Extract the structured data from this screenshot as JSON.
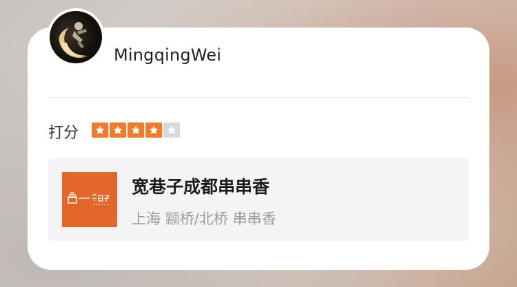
{
  "review": {
    "username": "MingqingWei",
    "rating_label": "打分",
    "rating": 4,
    "rating_max": 5
  },
  "shop": {
    "name": "宽巷子成都串串香",
    "city": "上海",
    "district": "颛桥/北桥",
    "category": "串串香"
  },
  "icons": {
    "avatar": "crescent-moon-figure-avatar",
    "star": "star-icon",
    "logo": "shop-logo"
  },
  "colors": {
    "star_filled": "#ef7b2c",
    "star_empty": "#d9d9d9",
    "logo_bg": "#e3672a"
  }
}
